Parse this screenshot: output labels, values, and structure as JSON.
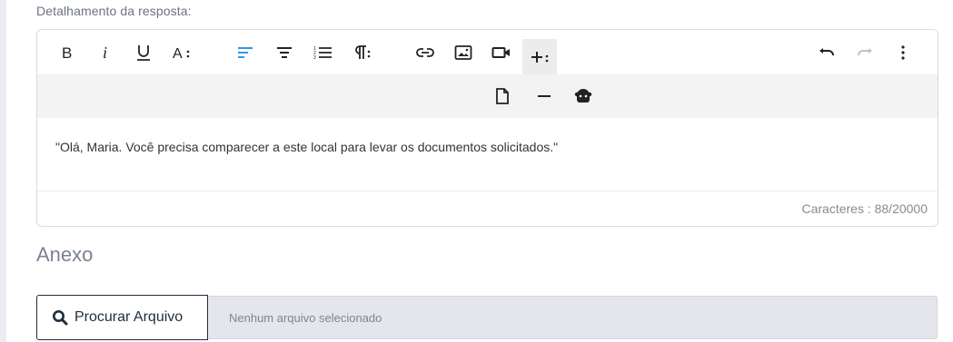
{
  "form": {
    "field_label": "Detalhamento da resposta:"
  },
  "editor": {
    "toolbar_row1": [
      "bold-icon",
      "italic-icon",
      "underline-icon",
      "font-size-icon",
      "align-left-icon",
      "align-center-icon",
      "ordered-list-icon",
      "paragraph-format-icon",
      "link-icon",
      "image-icon",
      "video-icon",
      "more-insert-icon",
      "undo-icon",
      "redo-icon",
      "more-vertical-icon"
    ],
    "toolbar_row2": [
      "file-icon",
      "horizontal-line-icon",
      "emoticon-icon"
    ],
    "active_color": "#2f96e6",
    "content": "\"Olá, Maria. Você precisa comparecer a este local para levar os documentos solicitados.\"",
    "char_count": "Caracteres : 88/20000"
  },
  "attachment": {
    "title": "Anexo",
    "browse_label": "Procurar Arquivo",
    "status": "Nenhum arquivo selecionado"
  }
}
